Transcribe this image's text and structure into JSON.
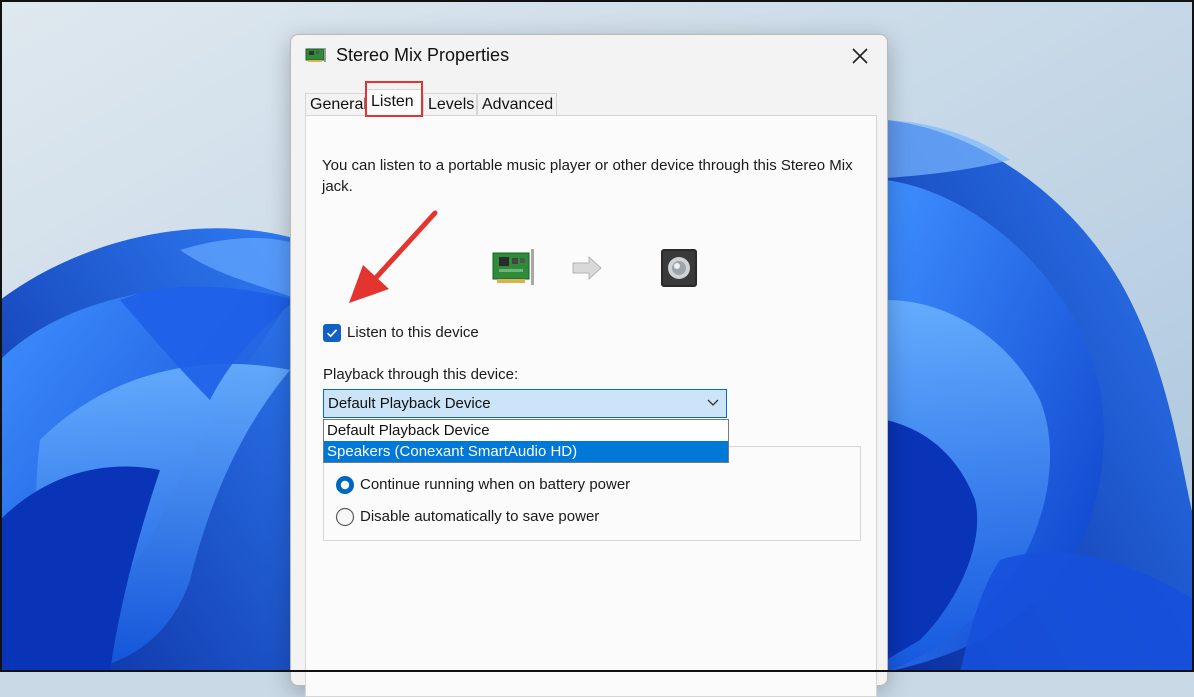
{
  "window": {
    "title": "Stereo Mix Properties",
    "close_symbol": "✕"
  },
  "tabs": [
    {
      "label": "General"
    },
    {
      "label": "Listen"
    },
    {
      "label": "Levels"
    },
    {
      "label": "Advanced"
    }
  ],
  "active_tab": "Listen",
  "listen": {
    "description": "You can listen to a portable music player or other device through this Stereo Mix jack.",
    "device_icons": [
      "sound-card-icon",
      "arrow-right-icon",
      "speaker-icon"
    ],
    "listen_checkbox_label": "Listen to this device",
    "listen_checked": true,
    "playback_label": "Playback through this device:",
    "playback_selected": "Default Playback Device",
    "playback_options": [
      "Default Playback Device",
      "Speakers (Conexant SmartAudio HD)"
    ],
    "highlighted_option": "Speakers (Conexant SmartAudio HD)",
    "power": {
      "options": [
        "Continue running when on battery power",
        "Disable automatically to save power"
      ],
      "selected": "Continue running when on battery power"
    }
  },
  "colors": {
    "accent": "#0078d7",
    "annotation": "#e3342f",
    "checkbox": "#1160c8"
  }
}
